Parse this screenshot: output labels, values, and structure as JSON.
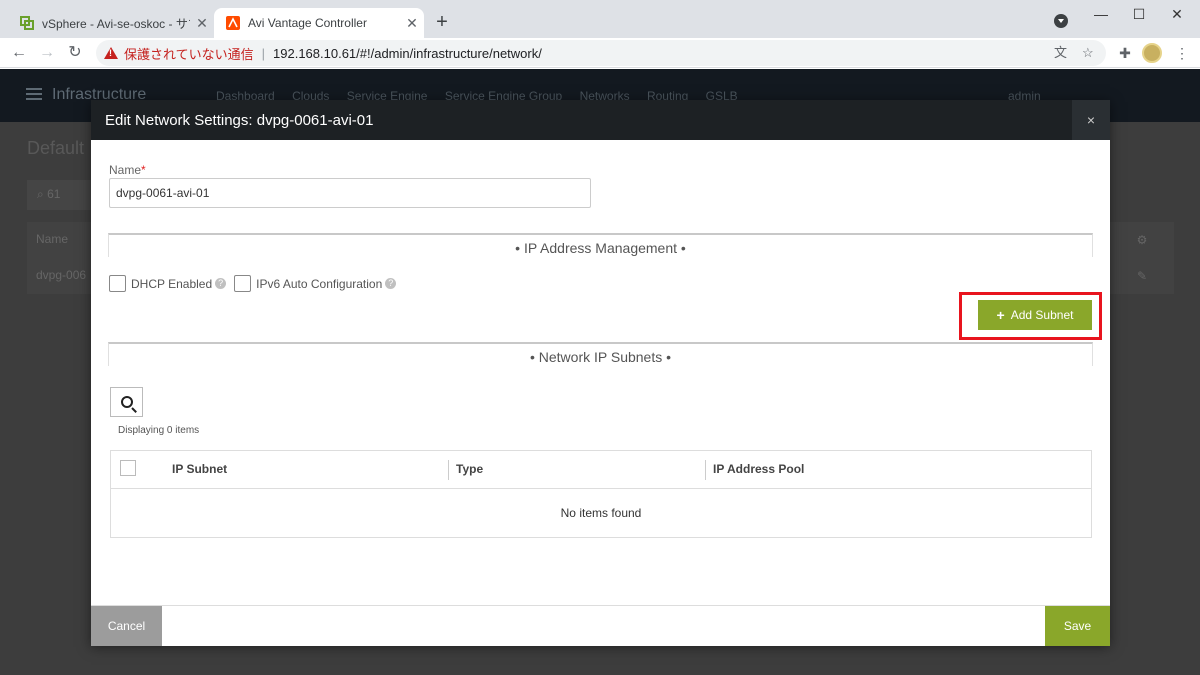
{
  "browser": {
    "tabs": [
      {
        "title": "vSphere - Avi-se-oskoc - サマリ",
        "active": false
      },
      {
        "title": "Avi Vantage Controller",
        "active": true
      }
    ],
    "security_warning": "保護されていない通信",
    "url": "192.168.10.61/#!/admin/infrastructure/network/",
    "icons": [
      "back-arrow-icon",
      "forward-arrow-icon",
      "reload-icon",
      "translate-icon",
      "star-icon",
      "extensions-icon",
      "menu-dots-icon"
    ]
  },
  "app": {
    "brand": "Infrastructure",
    "nav": [
      "Dashboard",
      "Clouds",
      "Service Engine",
      "Service Engine Group",
      "Networks",
      "Routing",
      "GSLB"
    ],
    "user": "admin",
    "page_title": "Default",
    "search_value": "61",
    "column_name": "Name",
    "row_name": "dvpg-006"
  },
  "modal": {
    "title": "Edit Network Settings: dvpg-0061-avi-01",
    "close": "×",
    "name_label": "Name",
    "name_value": "dvpg-0061-avi-01",
    "ipam_section": "• IP Address Management •",
    "dhcp_label": "DHCP Enabled",
    "ipv6_label": "IPv6 Auto Configuration",
    "add_subnet_label": "Add Subnet",
    "subnets_section": "• Network IP Subnets •",
    "display_count": "Displaying 0 items",
    "columns": [
      "IP Subnet",
      "Type",
      "IP Address Pool"
    ],
    "empty_message": "No items found",
    "cancel_label": "Cancel",
    "save_label": "Save"
  },
  "colors": {
    "accent_green": "#8aa72a",
    "highlight_red": "#e8141e",
    "header_dark": "#1d2124"
  }
}
